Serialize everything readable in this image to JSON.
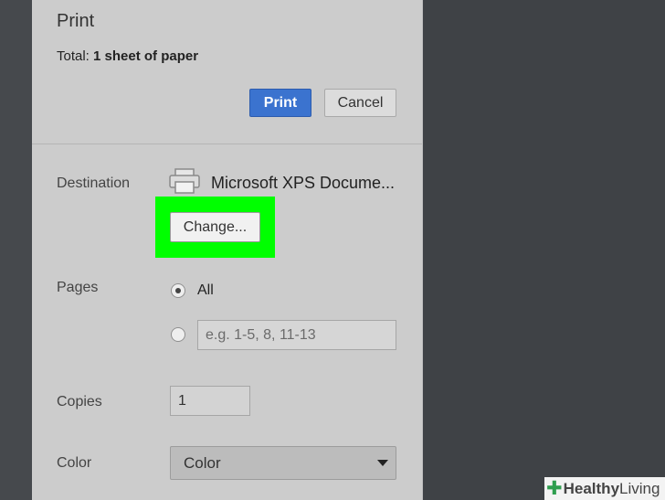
{
  "header": {
    "title": "Print",
    "total_prefix": "Total: ",
    "total_value": "1 sheet of paper"
  },
  "actions": {
    "print_label": "Print",
    "cancel_label": "Cancel"
  },
  "destination": {
    "label": "Destination",
    "printer_name": "Microsoft XPS Docume...",
    "change_label": "Change...",
    "icon": "printer-icon",
    "highlight_color": "#00ff00"
  },
  "pages": {
    "label": "Pages",
    "options": [
      {
        "label": "All",
        "selected": true
      },
      {
        "label": "",
        "placeholder": "e.g. 1-5, 8, 11-13",
        "selected": false
      }
    ]
  },
  "copies": {
    "label": "Copies",
    "value": "1"
  },
  "color": {
    "label": "Color",
    "selected": "Color"
  },
  "watermark": {
    "brand_bold": "Healthy",
    "brand_light": "Living"
  },
  "colors": {
    "accent": "#3b73cf",
    "panel": "#cccccc",
    "background": "#3f4246"
  }
}
